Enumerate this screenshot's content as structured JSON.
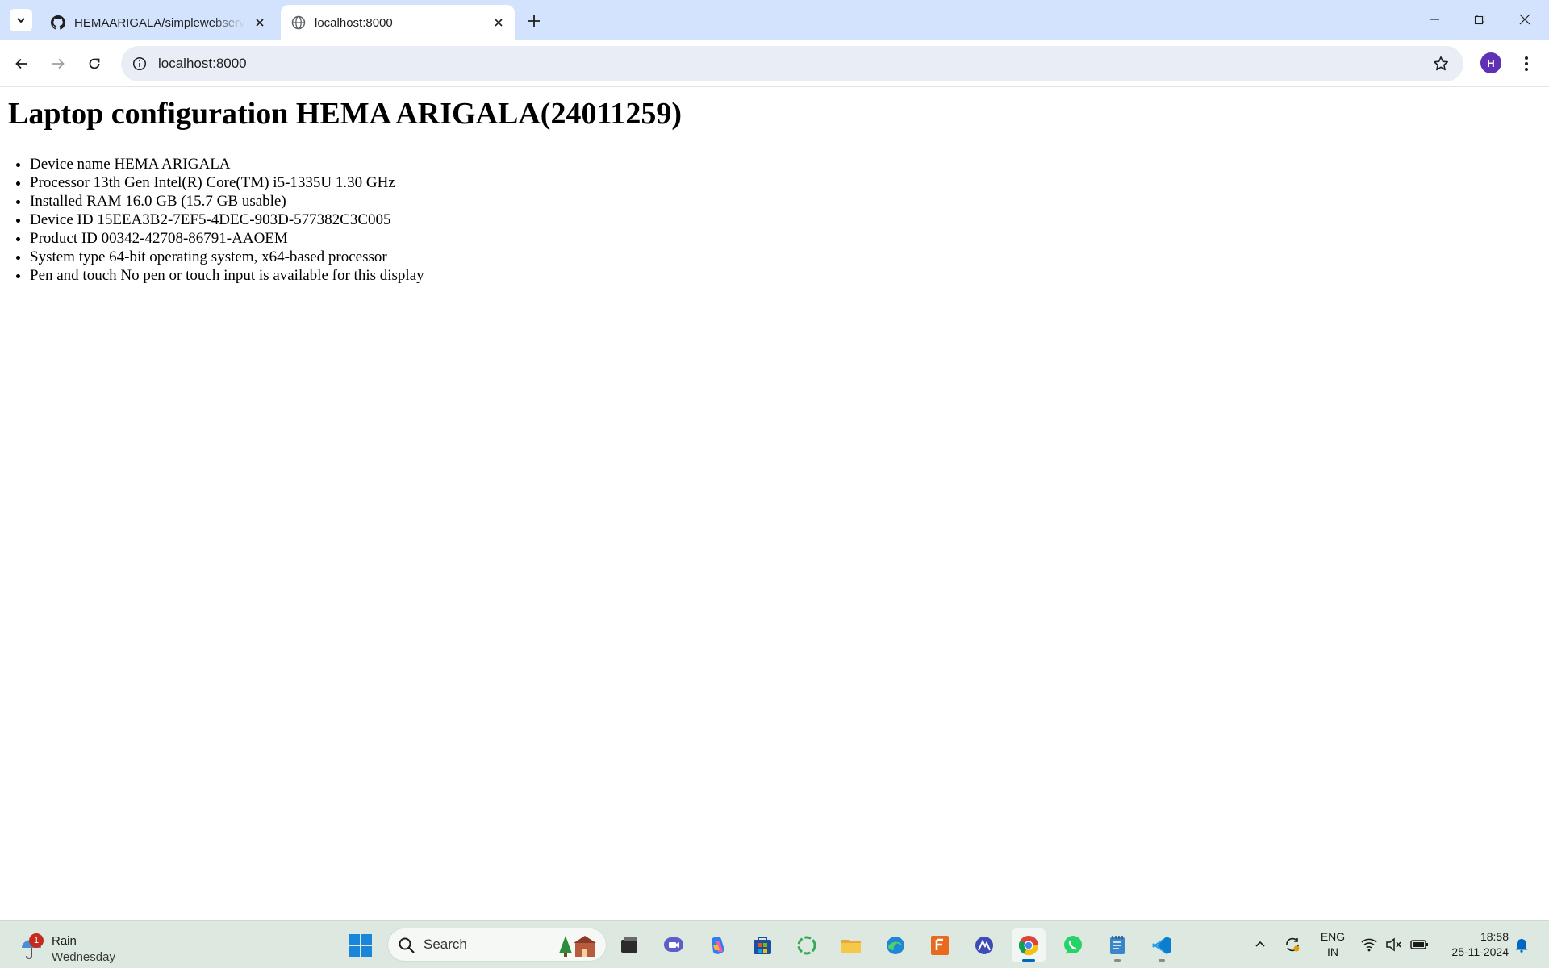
{
  "browser": {
    "tabs": [
      {
        "title": "HEMAARIGALA/simplewebserver",
        "active": false
      },
      {
        "title": "localhost:8000",
        "active": true
      }
    ],
    "address": "localhost:8000",
    "profile_initial": "H"
  },
  "page": {
    "heading": "Laptop configuration HEMA ARIGALA(24011259)",
    "specs": [
      "Device name HEMA ARIGALA",
      "Processor 13th Gen Intel(R) Core(TM) i5-1335U 1.30 GHz",
      "Installed RAM 16.0 GB (15.7 GB usable)",
      "Device ID 15EEA3B2-7EF5-4DEC-903D-577382C3C005",
      "Product ID 00342-42708-86791-AAOEM",
      "System type 64-bit operating system, x64-based processor",
      "Pen and touch No pen or touch input is available for this display"
    ]
  },
  "taskbar": {
    "weather": {
      "condition": "Rain",
      "day": "Wednesday",
      "badge": "1"
    },
    "search_label": "Search",
    "apps": [
      "file-manager-icon",
      "teams-meet-icon",
      "copilot-icon",
      "store-icon",
      "green-ring-icon",
      "file-explorer-icon",
      "edge-icon",
      "app-f-icon",
      "arc-app-icon",
      "chrome-icon",
      "whatsapp-icon",
      "notepad-icon",
      "vscode-icon"
    ],
    "language": {
      "line1": "ENG",
      "line2": "IN"
    },
    "clock": {
      "time": "18:58",
      "date": "25-11-2024"
    }
  },
  "colors": {
    "tabstrip": "#d3e3fd",
    "omnibox": "#e9eef6",
    "avatar": "#5f31b5",
    "taskbar": "#dde9e0",
    "accent": "#0067c0"
  }
}
